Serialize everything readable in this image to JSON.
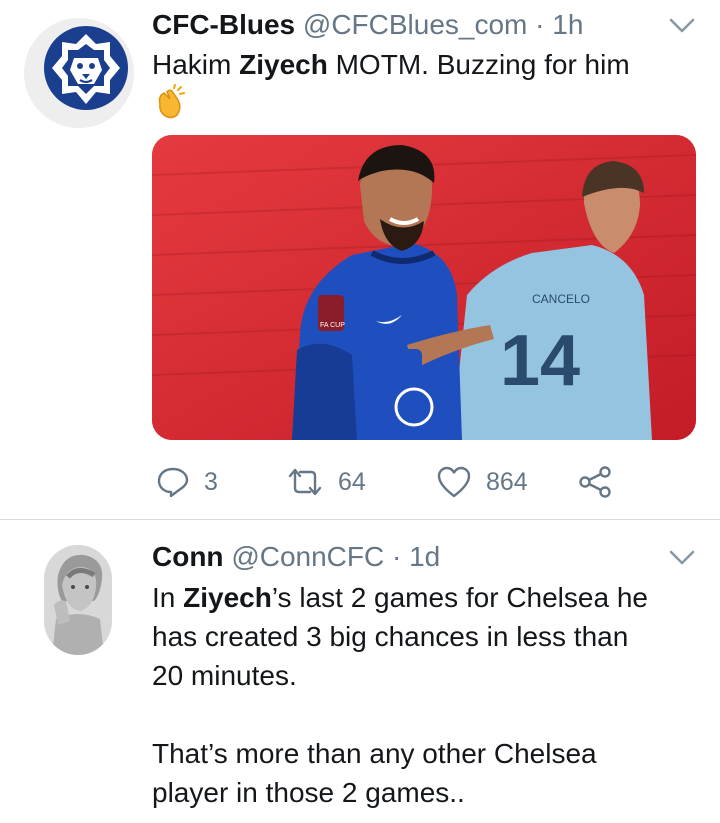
{
  "tweets": [
    {
      "author_name": "CFC-Blues",
      "handle": "@CFCBlues_com",
      "separator": "·",
      "time": "1h",
      "text_part1": "Hakim ",
      "text_bold": "Ziyech",
      "text_part2": " MOTM. Buzzing for him",
      "emoji": "clapping-hands",
      "media": {
        "player_left_badge": "FA CUP",
        "player_right_name": "CANCELO",
        "player_right_number": "14"
      },
      "actions": {
        "replies": "3",
        "retweets": "64",
        "likes": "864"
      }
    },
    {
      "author_name": "Conn",
      "handle": "@ConnCFC",
      "separator": "·",
      "time": "1d",
      "line1_pre": "In ",
      "line1_bold": "Ziyech",
      "line1_post": "’s last 2 games for Chelsea he",
      "line2": "has created 3 big chances in less than",
      "line3": "20 minutes.",
      "line4": "That’s more than any other Chelsea",
      "line5": "player in those 2 games.."
    }
  ],
  "colors": {
    "text": "#14171a",
    "secondary": "#657786",
    "brand_blue": "#1b3f8f",
    "divider": "#d9dde0"
  }
}
